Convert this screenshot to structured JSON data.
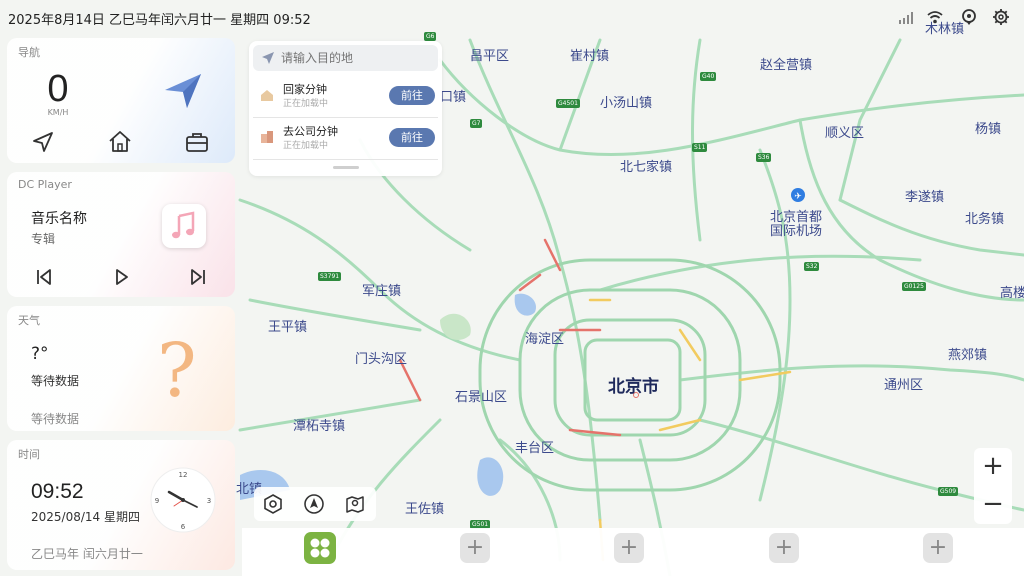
{
  "status_bar": {
    "datetime": "2025年8月14日   乙巳马年闰六月廿一   星期四   09:52",
    "icons": [
      "signal-icon",
      "wifi-icon",
      "location-pin-icon",
      "settings-gear-icon"
    ]
  },
  "nav_card": {
    "title": "导航",
    "speed": "0",
    "speed_unit": "KM/H",
    "buttons": [
      "navigate-arrow-icon",
      "home-icon",
      "briefcase-icon"
    ]
  },
  "music_card": {
    "title": "DC Player",
    "song": "音乐名称",
    "album": "专辑"
  },
  "weather_card": {
    "title": "天气",
    "temperature": "?°",
    "description": "等待数据",
    "sub": "等待数据",
    "icon_glyph": "?"
  },
  "time_card": {
    "title": "时间",
    "time": "09:52",
    "date": "2025/08/14 星期四",
    "lunar": "乙巳马年 闰六月廿一"
  },
  "search": {
    "placeholder": "请输入目的地",
    "favorites": [
      {
        "title": "回家分钟",
        "subtitle": "正在加载中",
        "button": "前往"
      },
      {
        "title": "去公司分钟",
        "subtitle": "正在加载中",
        "button": "前往"
      }
    ]
  },
  "map": {
    "labels": [
      {
        "text": "昌平区",
        "cls": "map-label"
      },
      {
        "text": "崔村镇",
        "cls": "map-label"
      },
      {
        "text": "赵全营镇",
        "cls": "map-label"
      },
      {
        "text": "木林镇",
        "cls": "map-label"
      },
      {
        "text": "口镇",
        "cls": "map-label"
      },
      {
        "text": "小汤山镇",
        "cls": "map-label"
      },
      {
        "text": "顺义区",
        "cls": "map-label"
      },
      {
        "text": "杨镇",
        "cls": "map-label"
      },
      {
        "text": "北七家镇",
        "cls": "map-label"
      },
      {
        "text": "李遂镇",
        "cls": "map-label"
      },
      {
        "text": "北京首都",
        "cls": "map-label"
      },
      {
        "text": "国际机场",
        "cls": "map-label"
      },
      {
        "text": "北务镇",
        "cls": "map-label"
      },
      {
        "text": "军庄镇",
        "cls": "map-label"
      },
      {
        "text": "高楼",
        "cls": "map-label"
      },
      {
        "text": "王平镇",
        "cls": "map-label"
      },
      {
        "text": "海淀区",
        "cls": "map-label"
      },
      {
        "text": "门头沟区",
        "cls": "map-label"
      },
      {
        "text": "燕郊镇",
        "cls": "map-label"
      },
      {
        "text": "北京市",
        "cls": "map-label city"
      },
      {
        "text": "石景山区",
        "cls": "map-label"
      },
      {
        "text": "通州区",
        "cls": "map-label"
      },
      {
        "text": "潭柘寺镇",
        "cls": "map-label"
      },
      {
        "text": "丰台区",
        "cls": "map-label"
      },
      {
        "text": "王佐镇",
        "cls": "map-label"
      },
      {
        "text": "北镇",
        "cls": "map-label"
      }
    ],
    "shields": [
      "G6",
      "G40",
      "G4501",
      "G7",
      "S11",
      "S36",
      "S3791",
      "S32",
      "G0125",
      "G509",
      "G501"
    ],
    "zoom_in": "+",
    "zoom_out": "−",
    "tools": [
      "settings-hexagon-icon",
      "compass-icon",
      "map-pin-icon"
    ]
  },
  "dock": {
    "add_label": "+"
  },
  "colors": {
    "accent": "#5a78b0",
    "road_green": "#9fd8b0",
    "traffic_red": "#e5736b",
    "traffic_yellow": "#f2cb5f"
  }
}
